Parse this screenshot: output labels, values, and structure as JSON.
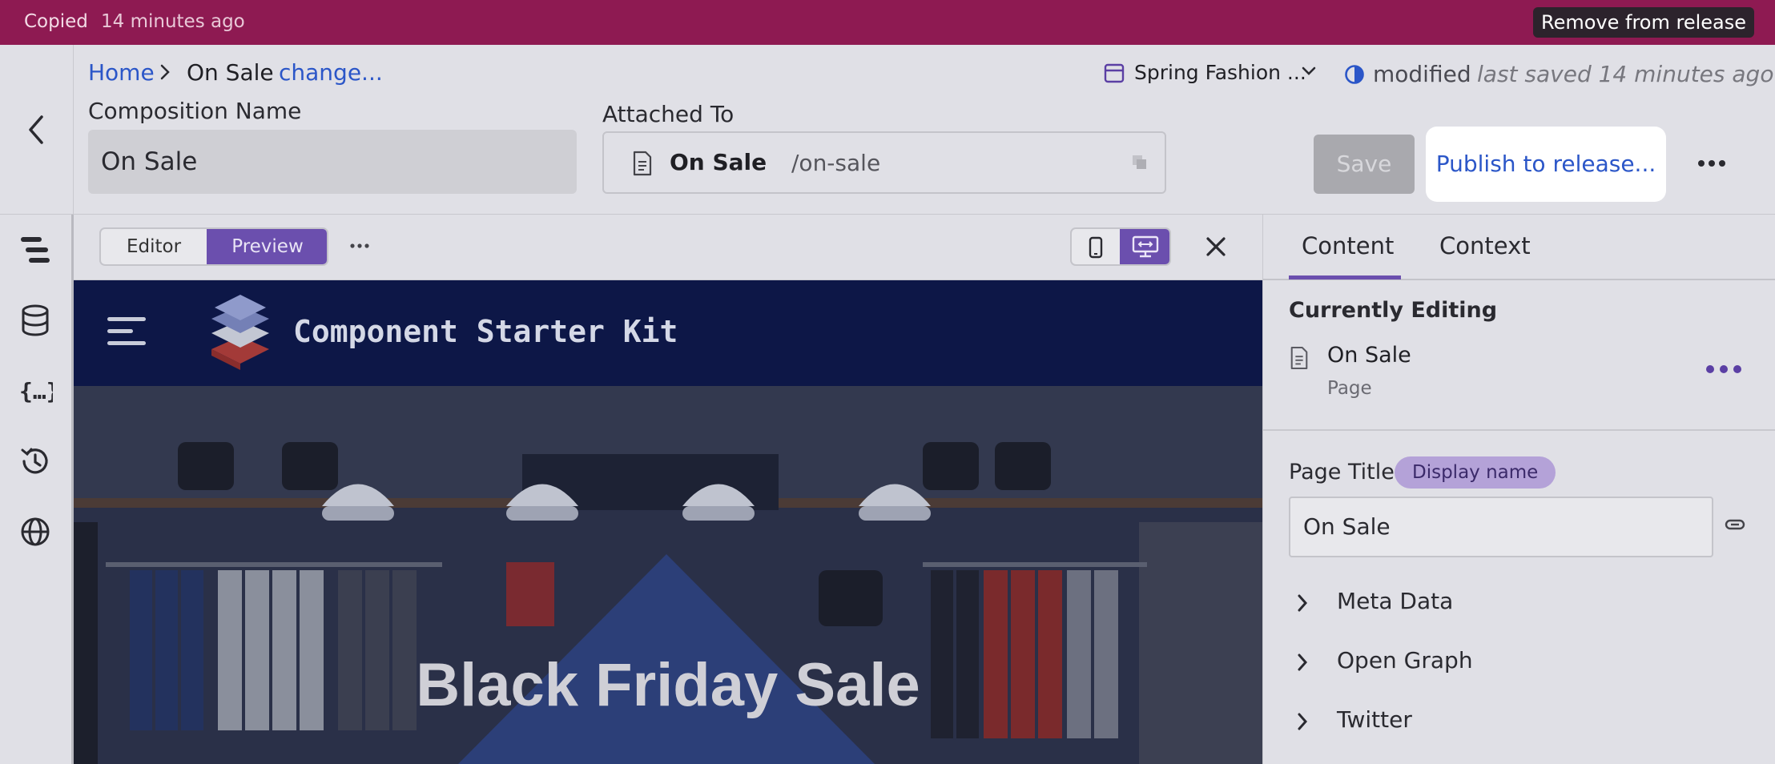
{
  "banner": {
    "status": "Copied",
    "time": "14 minutes ago",
    "remove_label": "Remove from release",
    "bg_color": "#8e1a52"
  },
  "breadcrumb": {
    "home": "Home",
    "current": "On Sale",
    "change": "change..."
  },
  "composition": {
    "name_label": "Composition Name",
    "name_value": "On Sale"
  },
  "attached": {
    "label": "Attached To",
    "name": "On Sale",
    "path": "/on-sale"
  },
  "release": {
    "name": "Spring Fashion ...",
    "status": "modified",
    "saved": "last saved 14 minutes ago"
  },
  "actions": {
    "save": "Save",
    "publish": "Publish to release..."
  },
  "sidebar": {
    "icons": [
      "structure-icon",
      "data-icon",
      "variables-icon",
      "history-icon",
      "globe-icon"
    ]
  },
  "preview_toolbar": {
    "editor": "Editor",
    "preview": "Preview",
    "active": "Preview",
    "device_active": "desktop"
  },
  "site": {
    "brand": "Component Starter Kit",
    "hero_title": "Black Friday Sale"
  },
  "panel": {
    "tabs": [
      "Content",
      "Context"
    ],
    "active_tab": "Content",
    "currently_editing": "Currently Editing",
    "item_name": "On Sale",
    "item_type": "Page",
    "page_title_label": "Page Title",
    "page_title_badge": "Display name",
    "page_title_value": "On Sale",
    "sections": [
      "Meta Data",
      "Open Graph",
      "Twitter"
    ]
  },
  "colors": {
    "accent": "#6b4fae",
    "link": "#2b56c8"
  }
}
